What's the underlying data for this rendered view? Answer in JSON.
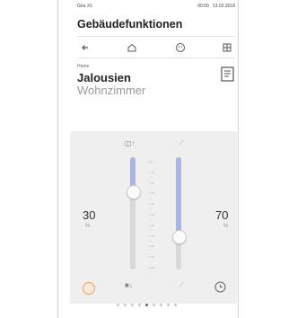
{
  "app": "Gira X1",
  "status": {
    "time": "00:00",
    "date": "13.02.2018"
  },
  "title": "Gebäudefunktionen",
  "nav": [
    "back-arrow-icon",
    "home-icon",
    "face-icon",
    "grid-icon"
  ],
  "section_small": "Home",
  "device": "Jalousien",
  "room": "Wohnzimmer",
  "left": {
    "value": "30",
    "unit": "%"
  },
  "right": {
    "value": "70",
    "unit": "%"
  },
  "slider_left_level": 0.7,
  "slider_right_level": 0.3,
  "ticks": [
    "0",
    "10",
    "20",
    "30",
    "40",
    "50",
    "60",
    "70",
    "80",
    "90",
    "100"
  ],
  "colors": {
    "accent": "#a9b6e3",
    "track": "#d9d9d9",
    "orange": "#f0a15b",
    "panel": "#efefef"
  },
  "pages": 9,
  "active_page": 4
}
